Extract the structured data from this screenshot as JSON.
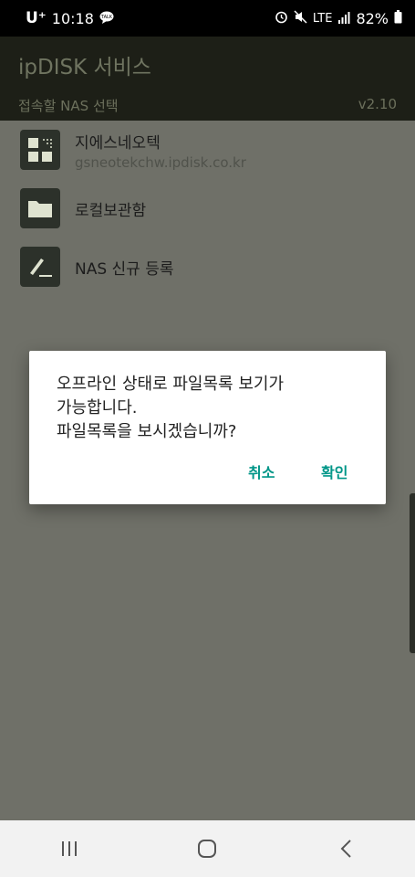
{
  "status_bar": {
    "carrier": "U⁺",
    "time": "10:18",
    "talk_badge": "TALK",
    "network": "LTE",
    "battery": "82%"
  },
  "app": {
    "title": "ipDISK 서비스",
    "subtitle": "접속할 NAS 선택",
    "version": "v2.10"
  },
  "list": [
    {
      "title": "지에스네오텍",
      "subtitle": "gsneotekchw.ipdisk.co.kr",
      "icon": "grid-icon"
    },
    {
      "title": "로컬보관함",
      "icon": "folder-icon"
    },
    {
      "title": "NAS 신규 등록",
      "icon": "pencil-icon"
    }
  ],
  "dialog": {
    "message": "오프라인 상태로 파일목록 보기가\n가능합니다.\n파일목록을 보시겠습니까?",
    "cancel": "취소",
    "confirm": "확인"
  },
  "colors": {
    "accent": "#009688",
    "dim_background": "#6f7068",
    "appbar": "#1d1f17"
  }
}
